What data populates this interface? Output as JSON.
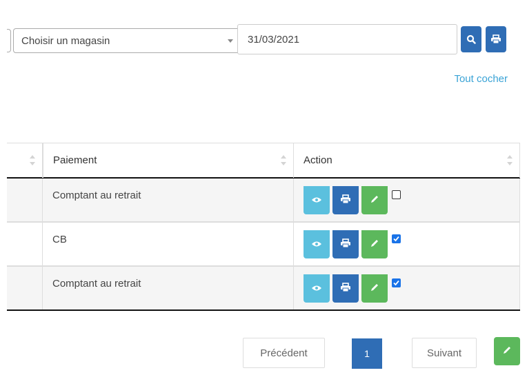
{
  "filters": {
    "store_select_value": "Choisir un magasin",
    "date_value": "31/03/2021"
  },
  "check_all_label": "Tout cocher",
  "table": {
    "columns": [
      "",
      "Paiement",
      "Action"
    ],
    "rows": [
      {
        "paiement": "Comptant au retrait",
        "checked": false
      },
      {
        "paiement": "CB",
        "checked": true
      },
      {
        "paiement": "Comptant au retrait",
        "checked": true
      }
    ]
  },
  "pagination": {
    "previous_label": "Précédent",
    "current_page": "1",
    "next_label": "Suivant"
  },
  "colors": {
    "primary": "#2f6db5",
    "info": "#5bc0de",
    "success": "#5cb85c",
    "link": "#3aa3d6"
  },
  "icons": {
    "search": "search-icon",
    "print": "print-icon",
    "view": "eye-icon",
    "edit": "pencil-icon"
  }
}
